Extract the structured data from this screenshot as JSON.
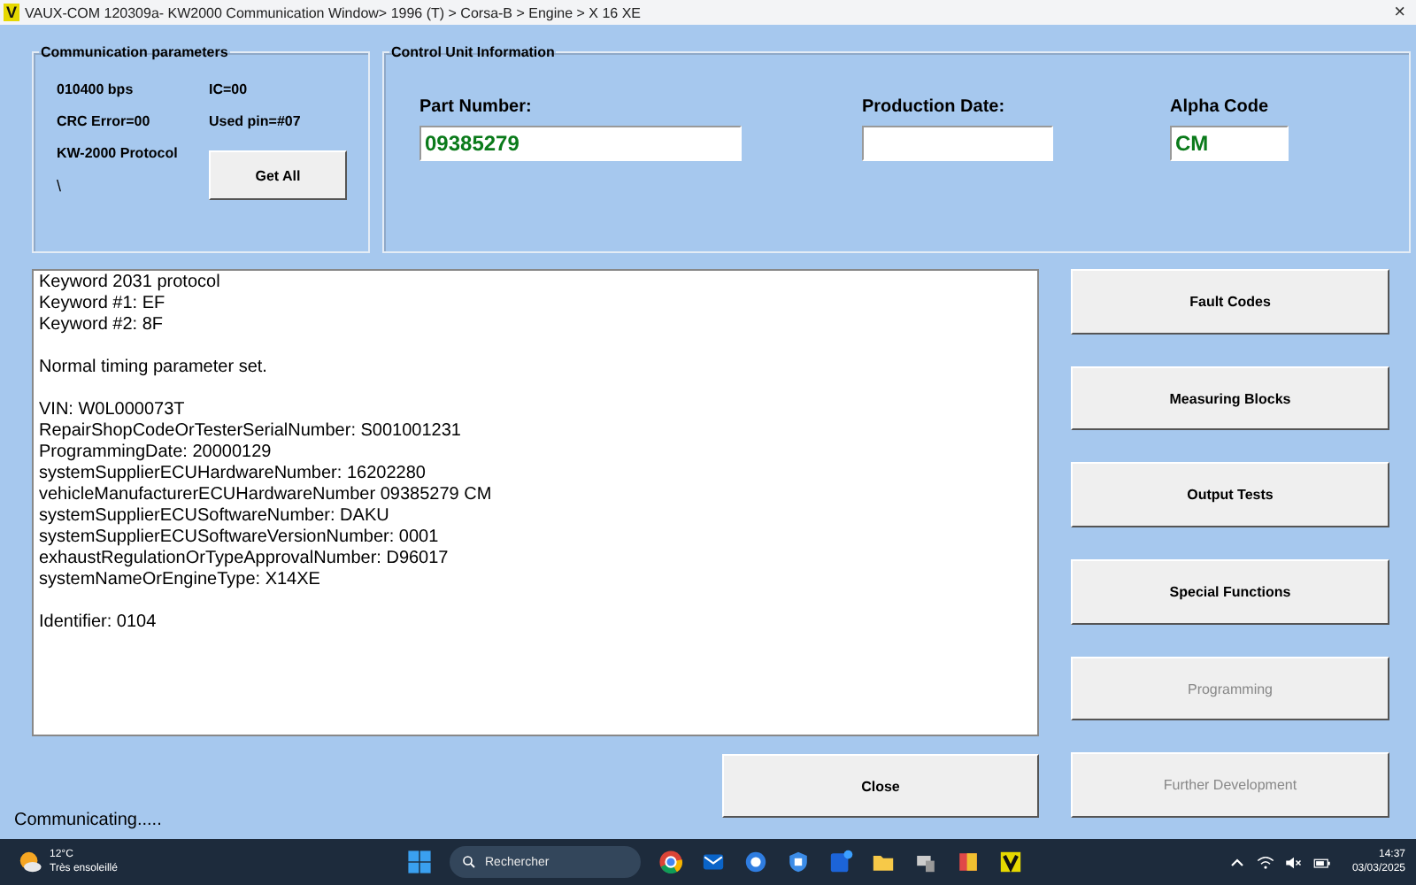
{
  "window": {
    "title": "VAUX-COM 120309a- KW2000 Communication Window> 1996 (T) > Corsa-B > Engine > X 16 XE",
    "logo": "V",
    "close": "×"
  },
  "communication_parameters": {
    "title": "Communication parameters",
    "items": [
      "010400 bps",
      "IC=00",
      "CRC Error=00",
      "Used pin=#07",
      "KW-2000 Protocol"
    ],
    "spinner": "\\",
    "button": "Get All"
  },
  "control_unit": {
    "title": "Control Unit Information",
    "fields": [
      {
        "label": "Part Number:",
        "value": "09385279"
      },
      {
        "label": "Production Date:"
      },
      {
        "label": "Alpha Code",
        "value": "CM"
      }
    ]
  },
  "log": [
    {
      "lines": [
        "Keyword 2031 protocol",
        "Keyword #1: EF",
        "Keyword #2: 8F"
      ]
    },
    {
      "lines": [
        "Normal timing parameter set."
      ]
    },
    {
      "lines": [
        "VIN: W0L000073T",
        "RepairShopCodeOrTesterSerialNumber:  S001001231",
        "ProgrammingDate:  20000129",
        "systemSupplierECUHardwareNumber: 16202280",
        "vehicleManufacturerECUHardwareNumber 09385279 CM",
        "systemSupplierECUSoftwareNumber: DAKU",
        "systemSupplierECUSoftwareVersionNumber: 0001",
        "exhaustRegulationOrTypeApprovalNumber: D96017",
        "systemNameOrEngineType:  X14XE"
      ]
    },
    {
      "lines": [
        "Identifier: 0104"
      ]
    }
  ],
  "function_buttons": [
    {
      "label": "Fault Codes",
      "disabled": false
    },
    {
      "label": "Measuring Blocks",
      "disabled": false
    },
    {
      "label": "Output Tests",
      "disabled": false
    },
    {
      "label": "Special Functions",
      "disabled": false
    },
    {
      "label": "Programming",
      "disabled": true
    },
    {
      "label": "Further Development",
      "disabled": true
    }
  ],
  "close_button": "Close",
  "status": "Communicating.....",
  "taskbar": {
    "temperature": "12°C",
    "weather": "Très ensoleillé",
    "search": {
      "placeholder": "Rechercher"
    },
    "time": "14:37",
    "date": "03/03/2025"
  }
}
